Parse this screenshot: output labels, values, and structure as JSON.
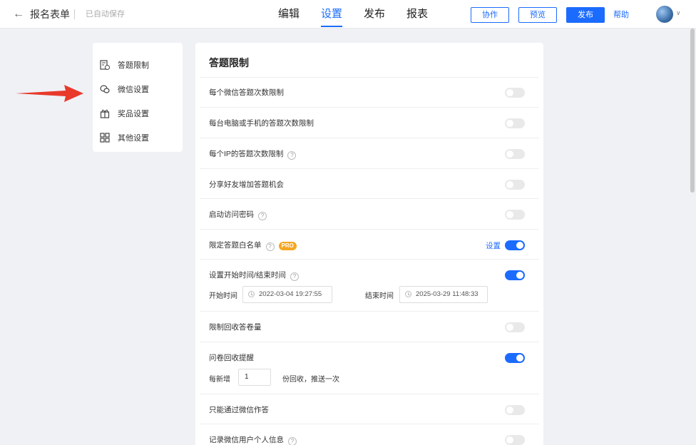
{
  "header": {
    "back_glyph": "←",
    "form_title": "报名表单",
    "save_status": "已自动保存",
    "tabs": [
      {
        "label": "编辑",
        "active": false
      },
      {
        "label": "设置",
        "active": true
      },
      {
        "label": "发布",
        "active": false
      },
      {
        "label": "报表",
        "active": false
      }
    ],
    "collab_label": "协作",
    "preview_label": "预览",
    "publish_label": "发布",
    "help_label": "帮助",
    "avatar_caret": "∨"
  },
  "sidebar": {
    "items": [
      {
        "label": "答题限制",
        "icon": "doc-clock-icon"
      },
      {
        "label": "微信设置",
        "icon": "wechat-icon"
      },
      {
        "label": "奖品设置",
        "icon": "gift-icon"
      },
      {
        "label": "其他设置",
        "icon": "grid-icon"
      }
    ]
  },
  "panel": {
    "title": "答题限制",
    "rows": [
      {
        "label": "每个微信答题次数限制",
        "enabled": false
      },
      {
        "label": "每台电脑或手机的答题次数限制",
        "enabled": false
      },
      {
        "label": "每个IP的答题次数限制",
        "enabled": false,
        "help": "?"
      },
      {
        "label": "分享好友增加答题机会",
        "enabled": false
      },
      {
        "label": "启动访问密码",
        "enabled": false,
        "help": "?"
      },
      {
        "label": "限定答题白名单",
        "enabled": true,
        "help": "?",
        "badge": "PRO",
        "link": "设置"
      },
      {
        "label": "设置开始时间/结束时间",
        "enabled": true,
        "help": "?"
      },
      {
        "label": "限制回收答卷量",
        "enabled": false
      },
      {
        "label": "问卷回收提醒",
        "enabled": true
      },
      {
        "label": "只能通过微信作答",
        "enabled": false
      },
      {
        "label": "记录微信用户个人信息",
        "enabled": false,
        "help": "?"
      }
    ],
    "time": {
      "start_label": "开始时间",
      "start_value": "2022-03-04 19:27:55",
      "end_label": "结束时间",
      "end_value": "2025-03-29 11:48:33"
    },
    "reminder": {
      "prefix": "每新增",
      "value": "1",
      "suffix": "份回收，推送一次"
    }
  },
  "colors": {
    "accent": "#1b6bff",
    "pro_badge": "#f5a623",
    "arrow": "#e8392b"
  }
}
